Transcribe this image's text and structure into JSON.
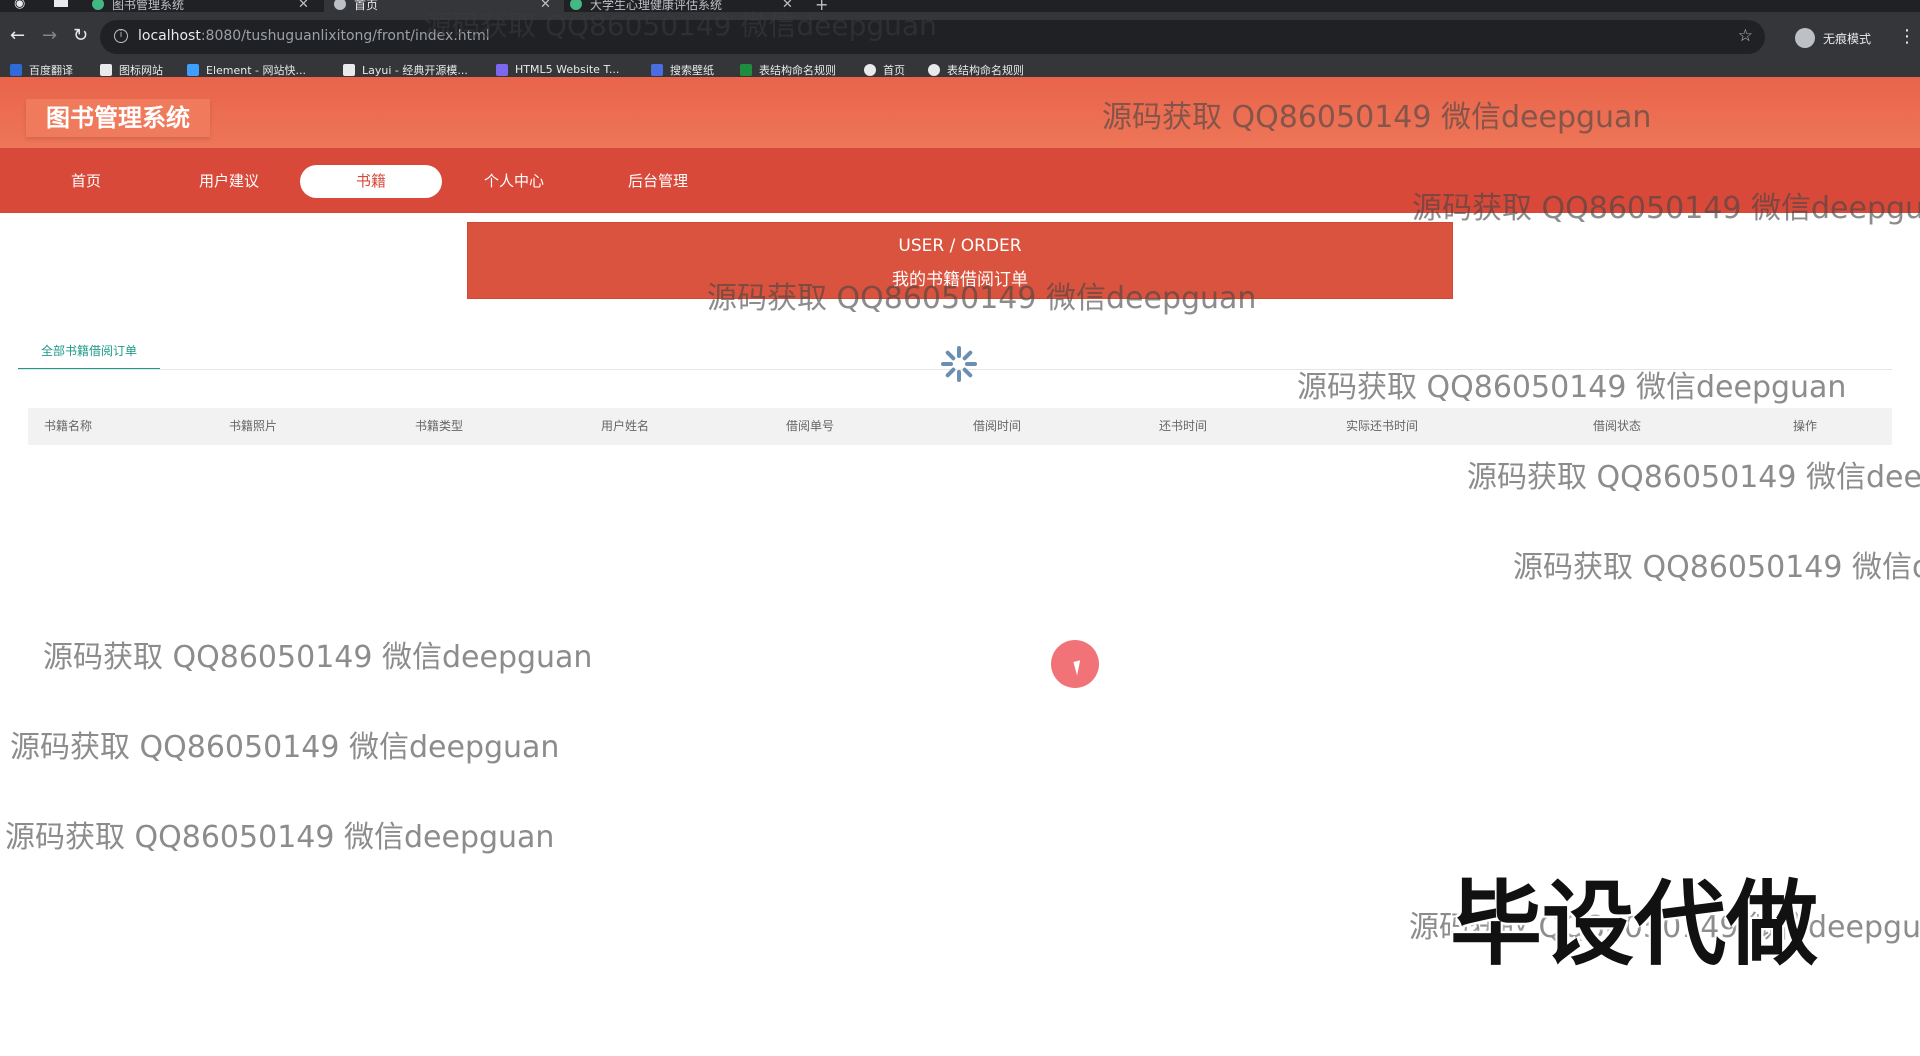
{
  "browser": {
    "tabs": [
      {
        "title": "图书管理系统",
        "active": false
      },
      {
        "title": "首页",
        "active": true
      },
      {
        "title": "大学生心理健康评估系统",
        "active": false
      }
    ],
    "new_tab": "+",
    "url_host": "localhost",
    "url_rest": ":8080/tushuguanlixitong/front/index.html",
    "incognito_label": "无痕模式",
    "bookmarks": [
      {
        "label": "百度翻译",
        "color": "#2f6bd8"
      },
      {
        "label": "图标网站",
        "color": "#e8eaed"
      },
      {
        "label": "Element - 网站快...",
        "color": "#409eff"
      },
      {
        "label": "Layui - 经典开源模...",
        "color": "#e8eaed"
      },
      {
        "label": "HTML5 Website T...",
        "color": "#7b68ee"
      },
      {
        "label": "搜索壁纸",
        "color": "#4a6ee0"
      },
      {
        "label": "表结构命名规则",
        "color": "#1e8e3e"
      },
      {
        "label": "首页",
        "color": "#e8eaed"
      },
      {
        "label": "表结构命名规则",
        "color": "#e8eaed"
      }
    ]
  },
  "site": {
    "title": "图书管理系统",
    "nav": [
      {
        "label": "首页",
        "active": false
      },
      {
        "label": "用户建议",
        "active": false
      },
      {
        "label": "书籍",
        "active": true
      },
      {
        "label": "个人中心",
        "active": false
      },
      {
        "label": "后台管理",
        "active": false
      }
    ],
    "banner": {
      "en": "USER / ORDER",
      "zh": "我的书籍借阅订单"
    },
    "subtab": "全部书籍借阅订单",
    "table_headers": [
      "书籍名称",
      "书籍照片",
      "书籍类型",
      "用户姓名",
      "借阅单号",
      "借阅时间",
      "还书时间",
      "实际还书时间",
      "借阅状态",
      "操作"
    ]
  },
  "overlay": {
    "watermark": "源码获取 QQ86050149 微信deepguan",
    "stamp": "毕设代做"
  },
  "colors": {
    "header": "#ee7658",
    "navbar": "#d9493a",
    "banner": "#d9533e",
    "accent_green": "#1c9a8a"
  }
}
